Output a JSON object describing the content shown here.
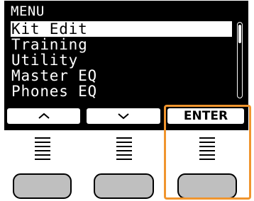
{
  "menu": {
    "title": "MENU",
    "items": [
      {
        "label": "Kit Edit",
        "selected": true
      },
      {
        "label": "Training",
        "selected": false
      },
      {
        "label": "Utility",
        "selected": false
      },
      {
        "label": "Master EQ",
        "selected": false
      },
      {
        "label": "Phones EQ",
        "selected": false
      }
    ]
  },
  "softkeys": {
    "up_icon": "up-arrow-icon",
    "down_icon": "down-arrow-icon",
    "enter_label": "ENTER"
  },
  "colors": {
    "screen": "#000000",
    "text": "#ffffff",
    "button": "#bfbfbf",
    "highlight": "#f0952e"
  }
}
